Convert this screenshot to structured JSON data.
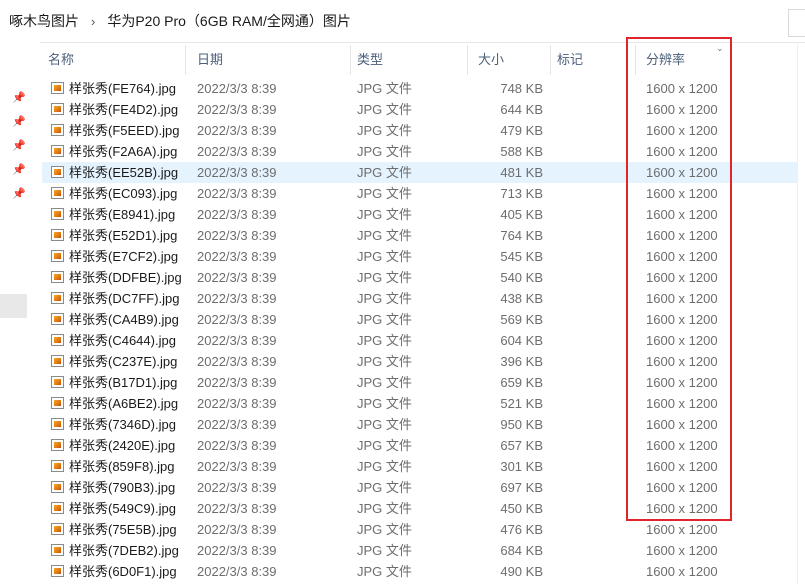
{
  "breadcrumb": {
    "items": [
      "啄木鸟图片",
      "华为P20 Pro（6GB RAM/全网通）图片"
    ],
    "separator": "›"
  },
  "columns": {
    "name": "名称",
    "date": "日期",
    "type": "类型",
    "size": "大小",
    "tag": "标记",
    "resolution": "分辨率",
    "sort_indicator": "⌄"
  },
  "pinned_icons": [
    "pin-icon",
    "pin-icon",
    "pin-icon",
    "pin-icon",
    "pin-icon"
  ],
  "files": [
    {
      "name": "样张秀(FE764).jpg",
      "date": "2022/3/3 8:39",
      "type": "JPG 文件",
      "size": "748 KB",
      "resolution": "1600 x 1200"
    },
    {
      "name": "样张秀(FE4D2).jpg",
      "date": "2022/3/3 8:39",
      "type": "JPG 文件",
      "size": "644 KB",
      "resolution": "1600 x 1200"
    },
    {
      "name": "样张秀(F5EED).jpg",
      "date": "2022/3/3 8:39",
      "type": "JPG 文件",
      "size": "479 KB",
      "resolution": "1600 x 1200"
    },
    {
      "name": "样张秀(F2A6A).jpg",
      "date": "2022/3/3 8:39",
      "type": "JPG 文件",
      "size": "588 KB",
      "resolution": "1600 x 1200"
    },
    {
      "name": "样张秀(EE52B).jpg",
      "date": "2022/3/3 8:39",
      "type": "JPG 文件",
      "size": "481 KB",
      "resolution": "1600 x 1200",
      "selected": true
    },
    {
      "name": "样张秀(EC093).jpg",
      "date": "2022/3/3 8:39",
      "type": "JPG 文件",
      "size": "713 KB",
      "resolution": "1600 x 1200"
    },
    {
      "name": "样张秀(E8941).jpg",
      "date": "2022/3/3 8:39",
      "type": "JPG 文件",
      "size": "405 KB",
      "resolution": "1600 x 1200"
    },
    {
      "name": "样张秀(E52D1).jpg",
      "date": "2022/3/3 8:39",
      "type": "JPG 文件",
      "size": "764 KB",
      "resolution": "1600 x 1200"
    },
    {
      "name": "样张秀(E7CF2).jpg",
      "date": "2022/3/3 8:39",
      "type": "JPG 文件",
      "size": "545 KB",
      "resolution": "1600 x 1200"
    },
    {
      "name": "样张秀(DDFBE).jpg",
      "date": "2022/3/3 8:39",
      "type": "JPG 文件",
      "size": "540 KB",
      "resolution": "1600 x 1200"
    },
    {
      "name": "样张秀(DC7FF).jpg",
      "date": "2022/3/3 8:39",
      "type": "JPG 文件",
      "size": "438 KB",
      "resolution": "1600 x 1200"
    },
    {
      "name": "样张秀(CA4B9).jpg",
      "date": "2022/3/3 8:39",
      "type": "JPG 文件",
      "size": "569 KB",
      "resolution": "1600 x 1200"
    },
    {
      "name": "样张秀(C4644).jpg",
      "date": "2022/3/3 8:39",
      "type": "JPG 文件",
      "size": "604 KB",
      "resolution": "1600 x 1200"
    },
    {
      "name": "样张秀(C237E).jpg",
      "date": "2022/3/3 8:39",
      "type": "JPG 文件",
      "size": "396 KB",
      "resolution": "1600 x 1200"
    },
    {
      "name": "样张秀(B17D1).jpg",
      "date": "2022/3/3 8:39",
      "type": "JPG 文件",
      "size": "659 KB",
      "resolution": "1600 x 1200"
    },
    {
      "name": "样张秀(A6BE2).jpg",
      "date": "2022/3/3 8:39",
      "type": "JPG 文件",
      "size": "521 KB",
      "resolution": "1600 x 1200"
    },
    {
      "name": "样张秀(7346D).jpg",
      "date": "2022/3/3 8:39",
      "type": "JPG 文件",
      "size": "950 KB",
      "resolution": "1600 x 1200"
    },
    {
      "name": "样张秀(2420E).jpg",
      "date": "2022/3/3 8:39",
      "type": "JPG 文件",
      "size": "657 KB",
      "resolution": "1600 x 1200"
    },
    {
      "name": "样张秀(859F8).jpg",
      "date": "2022/3/3 8:39",
      "type": "JPG 文件",
      "size": "301 KB",
      "resolution": "1600 x 1200"
    },
    {
      "name": "样张秀(790B3).jpg",
      "date": "2022/3/3 8:39",
      "type": "JPG 文件",
      "size": "697 KB",
      "resolution": "1600 x 1200"
    },
    {
      "name": "样张秀(549C9).jpg",
      "date": "2022/3/3 8:39",
      "type": "JPG 文件",
      "size": "450 KB",
      "resolution": "1600 x 1200"
    },
    {
      "name": "样张秀(75E5B).jpg",
      "date": "2022/3/3 8:39",
      "type": "JPG 文件",
      "size": "476 KB",
      "resolution": "1600 x 1200"
    },
    {
      "name": "样张秀(7DEB2).jpg",
      "date": "2022/3/3 8:39",
      "type": "JPG 文件",
      "size": "684 KB",
      "resolution": "1600 x 1200"
    },
    {
      "name": "样张秀(6D0F1).jpg",
      "date": "2022/3/3 8:39",
      "type": "JPG 文件",
      "size": "490 KB",
      "resolution": "1600 x 1200"
    }
  ],
  "colors": {
    "highlight_box": "#e0262a",
    "selected_row": "#e5f3ff",
    "header_text": "#4c607a"
  }
}
